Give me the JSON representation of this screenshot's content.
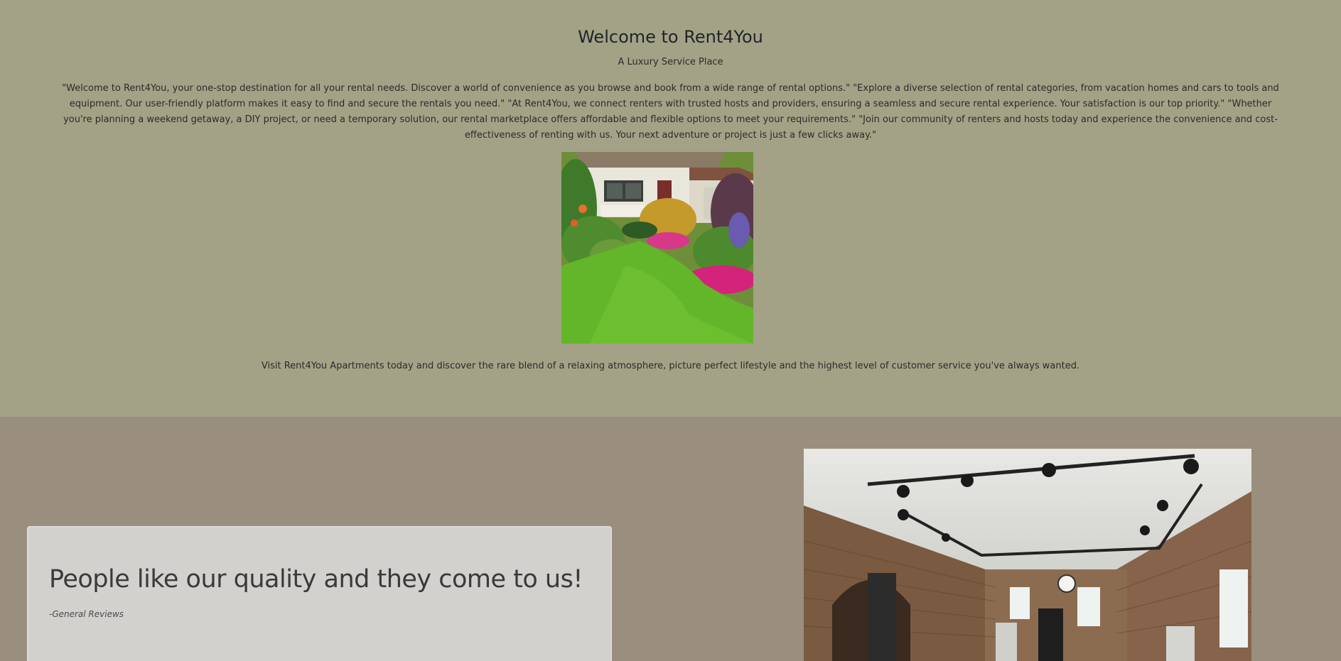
{
  "hero": {
    "title": "Welcome to Rent4You",
    "subtitle": "A Luxury Service Place",
    "intro": "\"Welcome to Rent4You, your one-stop destination for all your rental needs. Discover a world of convenience as you browse and book from a wide range of rental options.\" \"Explore a diverse selection of rental categories, from vacation homes and cars to tools and equipment. Our user-friendly platform makes it easy to find and secure the rentals you need.\" \"At Rent4You, we connect renters with trusted hosts and providers, ensuring a seamless and secure rental experience. Your satisfaction is our top priority.\" \"Whether you're planning a weekend getaway, a DIY project, or need a temporary solution, our rental marketplace offers affordable and flexible options to meet your requirements.\" \"Join our community of renters and hosts today and experience the convenience and cost-effectiveness of renting with us. Your next adventure or project is just a few clicks away.\"",
    "visit_text": "Visit Rent4You Apartments today and discover the rare blend of a relaxing atmosphere, picture perfect lifestyle and the highest level of customer service you've always wanted."
  },
  "testimonial": {
    "quote": "People like our quality and they come to us!",
    "source": "-General Reviews"
  },
  "colors": {
    "hero_bg": "#a3a286",
    "lower_bg": "#9a8e7e",
    "card_bg": "#d3d1cd"
  }
}
